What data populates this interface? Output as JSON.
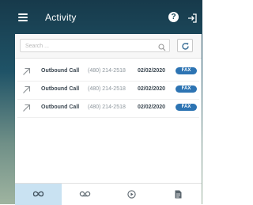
{
  "app": {
    "title": "Activity",
    "help_label": "?"
  },
  "search": {
    "placeholder": "Search ..."
  },
  "calls": [
    {
      "type": "Outbound Call",
      "phone": "(480) 214-2518",
      "date": "02/02/2020",
      "badge": "FAX"
    },
    {
      "type": "Outbound Call",
      "phone": "(480) 214-2518",
      "date": "02/02/2020",
      "badge": "FAX"
    },
    {
      "type": "Outbound Call",
      "phone": "(480) 214-2518",
      "date": "02/02/2020",
      "badge": "FAX"
    }
  ],
  "tabs": [
    {
      "icon": "infinity-icon",
      "active": true
    },
    {
      "icon": "voicemail-icon",
      "active": false
    },
    {
      "icon": "play-circle-icon",
      "active": false
    },
    {
      "icon": "document-icon",
      "active": false
    }
  ],
  "colors": {
    "accent": "#2d74b3",
    "active_tab": "#c9e2f2",
    "header_bg": "#1f5367"
  }
}
